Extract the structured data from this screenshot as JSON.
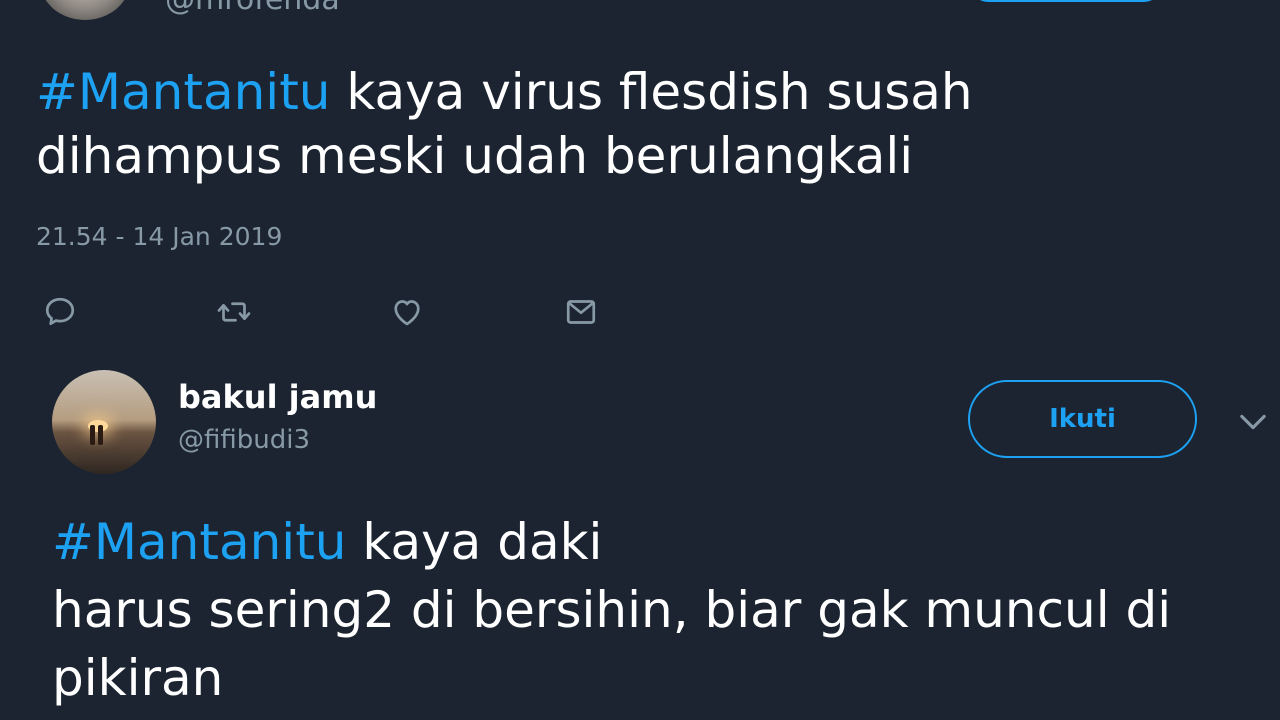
{
  "colors": {
    "background": "#1b2430",
    "accent": "#1da1f2",
    "muted": "#8899a6",
    "text": "#ffffff"
  },
  "tweet1": {
    "handle": "@mrofenda",
    "hashtag": "#Mantanitu",
    "text_rest": " kaya virus flesdish susah dihampus meski udah berulangkali",
    "timestamp": "21.54 - 14 Jan 2019",
    "actions": [
      {
        "icon": "reply-icon"
      },
      {
        "icon": "retweet-icon"
      },
      {
        "icon": "heart-icon"
      },
      {
        "icon": "message-icon"
      }
    ]
  },
  "tweet2": {
    "display_name": "bakul jamu",
    "handle": "@fifibudi3",
    "follow_label": "Ikuti",
    "menu_icon": "chevron-down-icon",
    "hashtag": "#Mantanitu",
    "line1_rest": " kaya daki",
    "line2": "harus sering2 di bersihin, biar gak muncul di",
    "line3": "pikiran"
  }
}
